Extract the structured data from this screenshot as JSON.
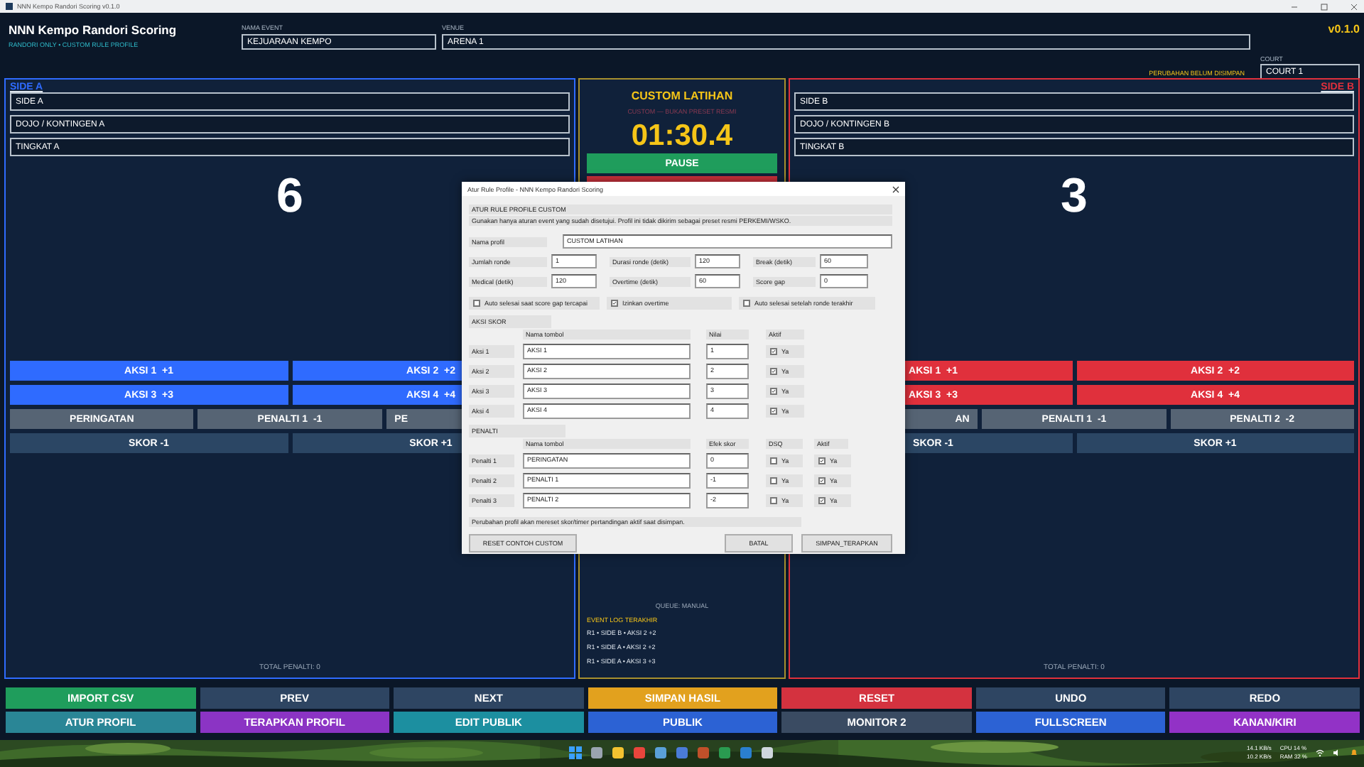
{
  "window": {
    "title": "NNN Kempo Randori Scoring v0.1.0"
  },
  "header": {
    "app_title": "NNN Kempo Randori Scoring",
    "subtitle": "RANDORI ONLY • CUSTOM RULE PROFILE",
    "event": {
      "label": "NAMA EVENT",
      "value": "KEJUARAAN KEMPO"
    },
    "venue": {
      "label": "VENUE",
      "value": "ARENA 1"
    },
    "version": "v0.1.0",
    "court": {
      "label": "COURT",
      "value": "COURT 1"
    },
    "unsaved_notice": "PERUBAHAN BELUM DISIMPAN"
  },
  "sides": [
    {
      "label": "SIDE A",
      "color": "#2f6bff",
      "name": "SIDE A",
      "team": "DOJO / KONTINGEN A",
      "grade": "TINGKAT A",
      "score": "6",
      "total_penalty": "TOTAL PENALTI: 0",
      "button_rows": [
        [
          {
            "label": "AKSI 1  +1",
            "kind": "action"
          },
          {
            "label": "AKSI 2  +2",
            "kind": "action"
          }
        ],
        [
          {
            "label": "AKSI 3  +3",
            "kind": "action"
          },
          {
            "label": "AKSI 4  +4",
            "kind": "action"
          }
        ],
        [
          {
            "label": "PERINGATAN",
            "kind": "penalty"
          },
          {
            "label": "PENALTI 1  -1",
            "kind": "penalty"
          },
          {
            "label": "PE",
            "kind": "penalty"
          }
        ],
        [
          {
            "label": "SKOR -1",
            "kind": "score"
          },
          {
            "label": "SKOR +1",
            "kind": "score"
          }
        ]
      ]
    },
    {
      "label": "SIDE B",
      "color": "#e0303c",
      "name": "SIDE B",
      "team": "DOJO / KONTINGEN B",
      "grade": "TINGKAT B",
      "score": "3",
      "total_penalty": "TOTAL PENALTI: 0",
      "button_rows": [
        [
          {
            "label": "AKSI 1  +1",
            "kind": "action"
          },
          {
            "label": "AKSI 2  +2",
            "kind": "action"
          }
        ],
        [
          {
            "label": "AKSI 3  +3",
            "kind": "action"
          },
          {
            "label": "AKSI 4  +4",
            "kind": "action"
          }
        ],
        [
          {
            "label": "AN",
            "kind": "penalty"
          },
          {
            "label": "PENALTI 1  -1",
            "kind": "penalty"
          },
          {
            "label": "PENALTI 2  -2",
            "kind": "penalty"
          }
        ],
        [
          {
            "label": "SKOR -1",
            "kind": "score"
          },
          {
            "label": "SKOR +1",
            "kind": "score"
          }
        ]
      ]
    }
  ],
  "center": {
    "profile": "CUSTOM LATIHAN",
    "profile_note": "CUSTOM — BUKAN PRESET RESMI",
    "timer": "01:30.4",
    "pause_button": "PAUSE",
    "queue": "QUEUE: MANUAL",
    "log_title": "EVENT LOG TERAKHIR",
    "log": [
      "R1 • SIDE B • AKSI 2 +2",
      "R1 • SIDE A • AKSI 2 +2",
      "R1 • SIDE A • AKSI 3 +3"
    ]
  },
  "dialog": {
    "title": "Atur Rule Profile - NNN Kempo Randori Scoring",
    "heading": "ATUR RULE PROFILE CUSTOM",
    "note": "Gunakan hanya aturan event yang sudah disetujui. Profil ini tidak dikirim sebagai preset resmi PERKEMI/WSKO.",
    "profile_name": {
      "label": "Nama profil",
      "value": "CUSTOM LATIHAN"
    },
    "fields": [
      {
        "label": "Jumlah ronde",
        "value": "1"
      },
      {
        "label": "Durasi ronde (detik)",
        "value": "120"
      },
      {
        "label": "Break (detik)",
        "value": "60"
      },
      {
        "label": "Medical (detik)",
        "value": "120"
      },
      {
        "label": "Overtime (detik)",
        "value": "60"
      },
      {
        "label": "Score gap",
        "value": "0"
      }
    ],
    "options": [
      {
        "label": "Auto selesai saat score gap tercapai",
        "checked": false
      },
      {
        "label": "Izinkan overtime",
        "checked": true
      },
      {
        "label": "Auto selesai setelah ronde terakhir",
        "checked": false
      }
    ],
    "actions": {
      "title": "AKSI SKOR",
      "columns": [
        "Nama tombol",
        "Nilai",
        "Aktif"
      ],
      "rows": [
        {
          "label": "Aksi 1",
          "name": "AKSI 1",
          "value": "1",
          "active": true,
          "active_label": "Ya"
        },
        {
          "label": "Aksi 2",
          "name": "AKSI 2",
          "value": "2",
          "active": true,
          "active_label": "Ya"
        },
        {
          "label": "Aksi 3",
          "name": "AKSI 3",
          "value": "3",
          "active": true,
          "active_label": "Ya"
        },
        {
          "label": "Aksi 4",
          "name": "AKSI 4",
          "value": "4",
          "active": true,
          "active_label": "Ya"
        }
      ]
    },
    "penalties": {
      "title": "PENALTI",
      "columns": [
        "Nama tombol",
        "Efek skor",
        "DSQ",
        "Aktif"
      ],
      "rows": [
        {
          "label": "Penalti 1",
          "name": "PERINGATAN",
          "value": "0",
          "dsq": false,
          "dsq_label": "Ya",
          "active": true,
          "active_label": "Ya"
        },
        {
          "label": "Penalti 2",
          "name": "PENALTI 1",
          "value": "-1",
          "dsq": false,
          "dsq_label": "Ya",
          "active": true,
          "active_label": "Ya"
        },
        {
          "label": "Penalti 3",
          "name": "PENALTI 2",
          "value": "-2",
          "dsq": false,
          "dsq_label": "Ya",
          "active": true,
          "active_label": "Ya"
        }
      ]
    },
    "footer_note": "Perubahan profil akan mereset skor/timer pertandingan aktif saat disimpan.",
    "buttons": [
      "RESET CONTOH CUSTOM",
      "BATAL",
      "SIMPAN_TERAPKAN"
    ]
  },
  "toolbar": [
    {
      "label": "IMPORT CSV",
      "color": "#1f9d5c"
    },
    {
      "label": "PREV",
      "color": "#2e4562"
    },
    {
      "label": "NEXT",
      "color": "#2e4562"
    },
    {
      "label": "SIMPAN HASIL",
      "color": "#e2a11e"
    },
    {
      "label": "RESET",
      "color": "#d4323f"
    },
    {
      "label": "UNDO",
      "color": "#2e4562"
    },
    {
      "label": "REDO",
      "color": "#2e4562"
    },
    {
      "label": "ATUR PROFIL",
      "color": "#2a8696"
    },
    {
      "label": "TERAPKAN PROFIL",
      "color": "#8b34c4"
    },
    {
      "label": "EDIT PUBLIK",
      "color": "#1c8fa0"
    },
    {
      "label": "PUBLIK",
      "color": "#2c62d4"
    },
    {
      "label": "MONITOR 2",
      "color": "#3a4b62"
    },
    {
      "label": "FULLSCREEN",
      "color": "#2c62d4"
    },
    {
      "label": "KANAN/KIRI",
      "color": "#9232c6"
    }
  ],
  "taskbar": {
    "tray": [
      "14.1 KB/s",
      "10.2 KB/s",
      "CPU 14 %",
      "RAM 32 %"
    ]
  }
}
